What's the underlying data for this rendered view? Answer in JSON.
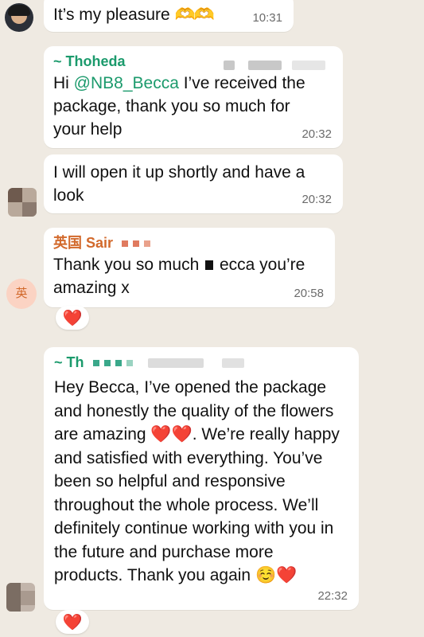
{
  "messages": [
    {
      "text": "It’s my pleasure",
      "emoji": "🫶🫶",
      "time": "10:31"
    },
    {
      "sender": "~ Thoheda",
      "mention": "@NB8_Becca",
      "text": " I’ve received the package, thank you so much for your help",
      "time": "20:32"
    },
    {
      "text": "I will open it up shortly and have a look",
      "time": "20:32"
    },
    {
      "sender": "英国 Sair",
      "text_before": "Thank you so much",
      "text_after": "ecca you’re amazing x",
      "time": "20:58",
      "reaction": "❤️"
    },
    {
      "sender": "~ Th",
      "line_a": "Hey Becca, I’ve opened the package and honestly the quality of the flowers are amazing",
      "hearts": "❤️❤️",
      "line_b": ". We’re really happy and satisfied with everything. You’ve been so helpful and responsive throughout the whole process. We’ll definitely continue working with you in the future and purchase more products. Thank you again",
      "end_emoji": "☺️❤️",
      "time": "22:32",
      "reaction": "❤️"
    }
  ],
  "avatars": {
    "sair_initial": "英"
  },
  "colors": {
    "background": "#efeae2",
    "sender_teal": "#1b9a6c",
    "sender_orange": "#d2692b"
  }
}
